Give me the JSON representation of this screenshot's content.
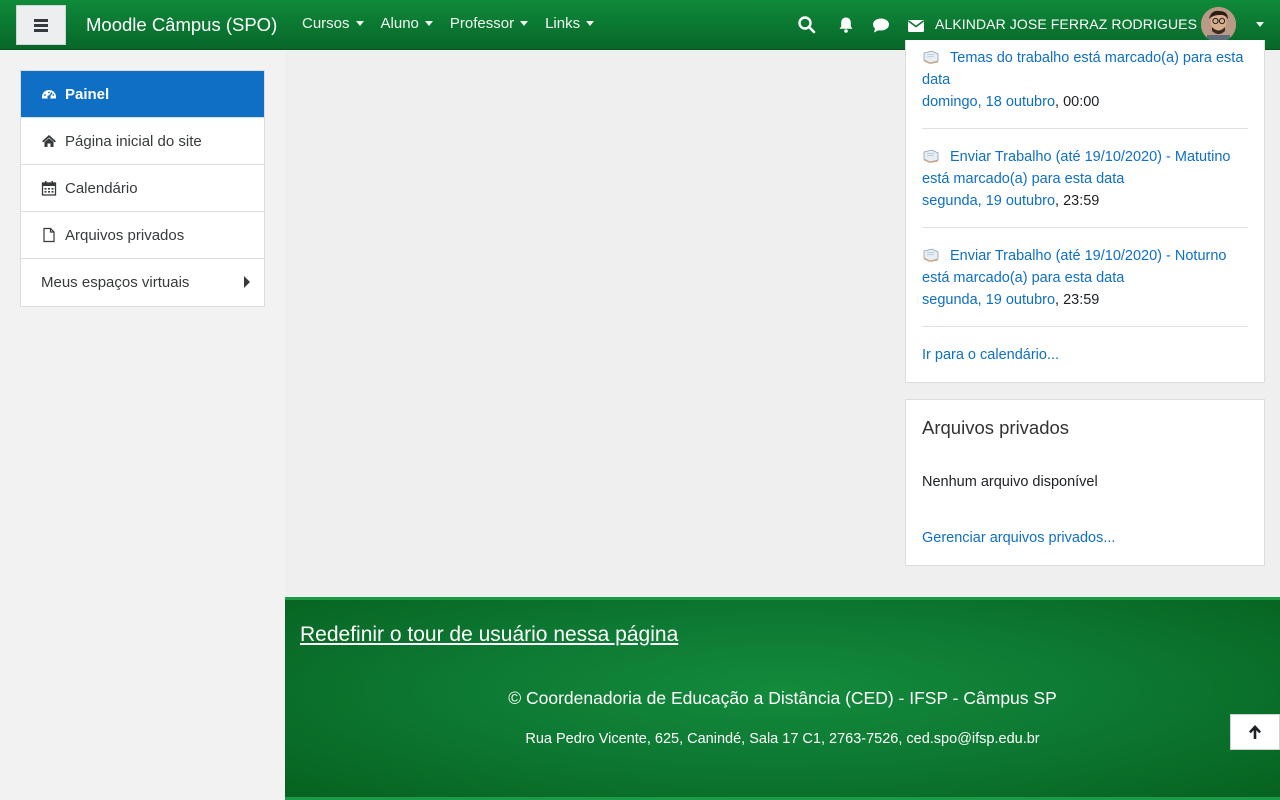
{
  "navbar": {
    "brand": "Moodle Câmpus (SPO)",
    "menu": [
      "Cursos",
      "Aluno",
      "Professor",
      "Links"
    ],
    "user_name": "ALKINDAR JOSE FERRAZ RODRIGUES",
    "icons": [
      "hamburger-icon",
      "search-icon",
      "bell-icon",
      "chat-icon",
      "envelope-icon",
      "chevron-down-icon"
    ]
  },
  "sidebar": {
    "items": [
      {
        "label": "Painel",
        "icon": "dashboard-icon",
        "active": true
      },
      {
        "label": "Página inicial do site",
        "icon": "home-icon"
      },
      {
        "label": "Calendário",
        "icon": "calendar-icon"
      },
      {
        "label": "Arquivos privados",
        "icon": "file-icon"
      },
      {
        "label": "Meus espaços virtuais",
        "icon": "caret-right-icon"
      }
    ]
  },
  "upcoming_events": {
    "events": [
      {
        "title": "Temas do trabalho está marcado(a) para esta data",
        "date": "domingo, 18 outubro",
        "time": ", 00:00"
      },
      {
        "title": "Enviar Trabalho (até 19/10/2020) - Matutino está marcado(a) para esta data",
        "date": "segunda, 19 outubro",
        "time": ", 23:59"
      },
      {
        "title": "Enviar Trabalho (até 19/10/2020) - Noturno está marcado(a) para esta data",
        "date": "segunda, 19 outubro",
        "time": ", 23:59"
      }
    ],
    "calendar_link": "Ir para o calendário..."
  },
  "private_files": {
    "title": "Arquivos privados",
    "empty_text": "Nenhum arquivo disponível",
    "manage_link": "Gerenciar arquivos privados..."
  },
  "footer": {
    "tour_link": "Redefinir o tour de usuário nessa página",
    "copyright": "© Coordenadoria de Educação a Distância (CED) - IFSP - Câmpus SP",
    "address": "Rua Pedro Vicente, 625, Canindé, Sala 17 C1, 2763-7526, ced.spo@ifsp.edu.br"
  },
  "colors": {
    "navbar_green": "#0a7530",
    "active_blue": "#0f6fc5",
    "link_blue": "#0f6fc5",
    "footer_green": "#0d7a33"
  }
}
